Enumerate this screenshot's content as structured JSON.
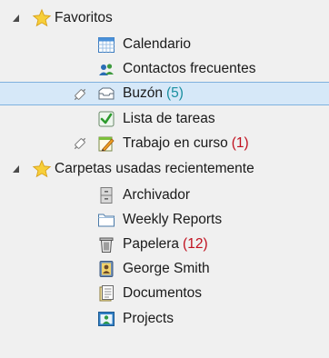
{
  "tree": {
    "favorites": {
      "label": "Favoritos",
      "items": [
        {
          "label": "Calendario",
          "icon": "calendar-icon",
          "count": ""
        },
        {
          "label": "Contactos frecuentes",
          "icon": "contacts-icon",
          "count": ""
        },
        {
          "label": "Buzón",
          "icon": "inbox-icon",
          "count": "(5)",
          "selected": true,
          "pinned": true
        },
        {
          "label": "Lista de tareas",
          "icon": "task-checkbox-icon",
          "count": ""
        },
        {
          "label": "Trabajo en curso",
          "icon": "edit-note-icon",
          "count": "(1)",
          "pinned": true
        }
      ]
    },
    "recent": {
      "label": "Carpetas usadas recientemente",
      "items": [
        {
          "label": "Archivador",
          "icon": "cabinet-icon",
          "count": ""
        },
        {
          "label": "Weekly Reports",
          "icon": "folder-icon",
          "count": ""
        },
        {
          "label": "Papelera",
          "icon": "trash-icon",
          "count": "(12)"
        },
        {
          "label": "George Smith",
          "icon": "address-book-icon",
          "count": ""
        },
        {
          "label": "Documentos",
          "icon": "documents-icon",
          "count": ""
        },
        {
          "label": "Projects",
          "icon": "project-icon",
          "count": ""
        }
      ]
    }
  },
  "colors": {
    "background": "#f0f0f0",
    "selection": "#d6e8f8",
    "selection_border": "#7fb1de",
    "count_red": "#c0101e",
    "count_teal": "#1a8fa0",
    "star": "#f5c518"
  }
}
